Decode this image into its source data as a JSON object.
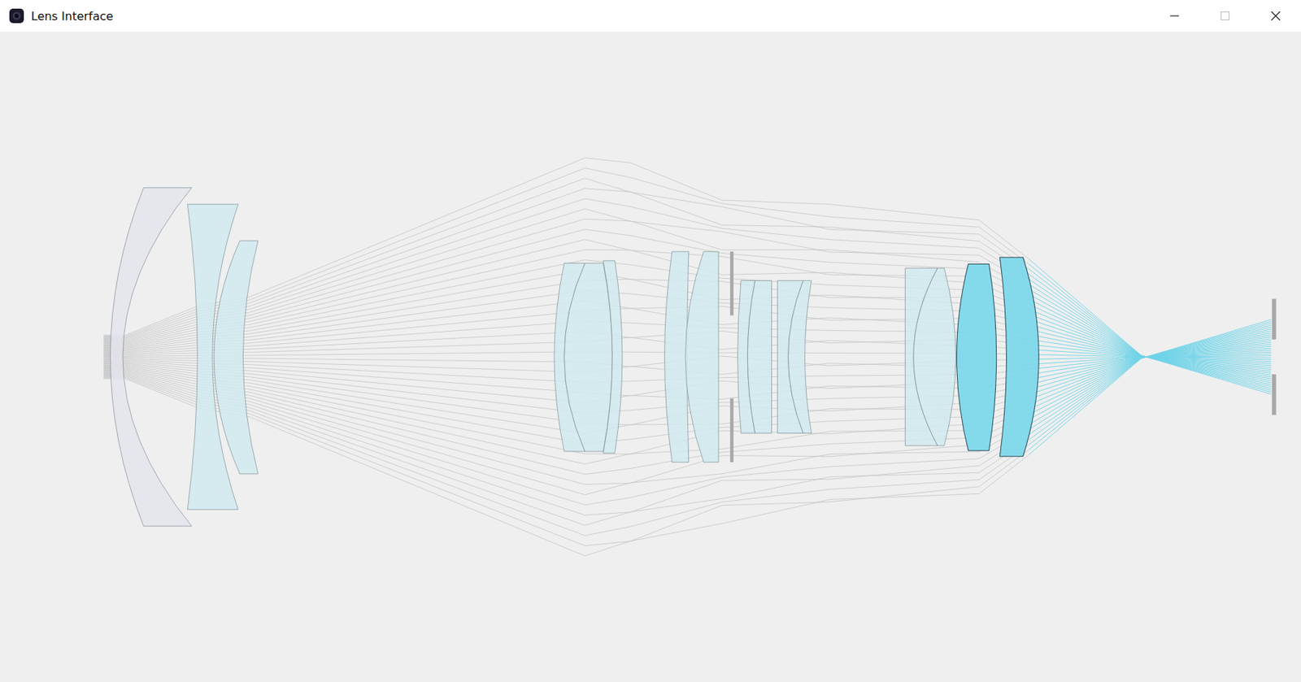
{
  "window": {
    "title": "Lens Interface"
  },
  "elements": [
    {
      "selected": false,
      "color": "#e4e4ec"
    },
    {
      "selected": false,
      "color": "#d0eaee"
    },
    {
      "selected": false,
      "color": "#d0eaee"
    },
    {
      "selected": false,
      "color": "#d0eaee"
    },
    {
      "selected": false,
      "color": "#d0eaee"
    },
    {
      "selected": false,
      "color": "#d0eaee"
    },
    {
      "selected": false,
      "color": "#d0eaee"
    },
    {
      "selected": false,
      "color": "#d0eaee"
    },
    {
      "selected": false,
      "color": "#d0eaee"
    },
    {
      "selected": false,
      "color": "#d0eaee"
    },
    {
      "selected": false,
      "color": "#d0eaee"
    },
    {
      "selected": false,
      "color": "#d0eaee"
    },
    {
      "selected": false,
      "color": "#d0eaee"
    },
    {
      "selected": false,
      "color": "#d0eaee"
    },
    {
      "selected": true,
      "color": "#7dd8ea"
    },
    {
      "selected": true,
      "color": "#7dd8ea"
    }
  ]
}
